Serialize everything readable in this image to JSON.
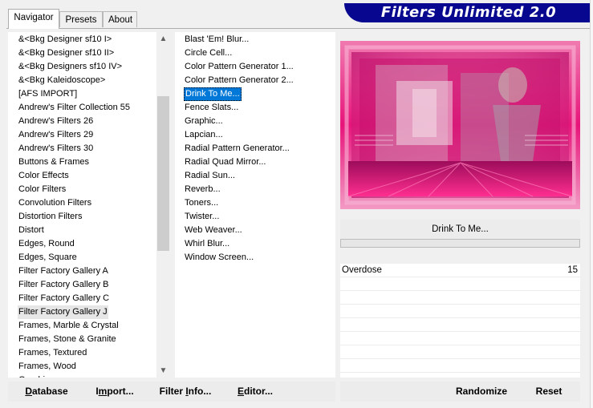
{
  "tabs": [
    {
      "label": "Navigator",
      "active": true
    },
    {
      "label": "Presets",
      "active": false
    },
    {
      "label": "About",
      "active": false
    }
  ],
  "banner": {
    "title": "Filters Unlimited 2.0"
  },
  "categories": [
    "&<Bkg Designer sf10 I>",
    "&<Bkg Designer sf10 II>",
    "&<Bkg Designers sf10 IV>",
    "&<Bkg Kaleidoscope>",
    "[AFS IMPORT]",
    "Andrew's Filter Collection 55",
    "Andrew's Filters 26",
    "Andrew's Filters 29",
    "Andrew's Filters 30",
    "Buttons & Frames",
    "Color Effects",
    "Color Filters",
    "Convolution Filters",
    "Distortion Filters",
    "Distort",
    "Edges, Round",
    "Edges, Square",
    "Filter Factory Gallery A",
    "Filter Factory Gallery B",
    "Filter Factory Gallery C",
    "Filter Factory Gallery J",
    "Frames, Marble & Crystal",
    "Frames, Stone & Granite",
    "Frames, Textured",
    "Frames, Wood",
    "Graphic..."
  ],
  "selected_category": "Filter Factory Gallery J",
  "filters": [
    "Blast 'Em! Blur...",
    "Circle Cell...",
    "Color Pattern Generator 1...",
    "Color Pattern Generator 2...",
    "Drink To Me...",
    "Fence Slats...",
    "Graphic...",
    "Lapcian...",
    "Radial Pattern Generator...",
    "Radial Quad Mirror...",
    "Radial Sun...",
    "Reverb...",
    "Toners...",
    "Twister...",
    "Web Weaver...",
    "Whirl Blur...",
    "Window Screen..."
  ],
  "selected_filter": "Drink To Me...",
  "filter_name": "Drink To Me...",
  "parameters": [
    {
      "name": "Overdose",
      "value": "15"
    }
  ],
  "buttons": {
    "database": {
      "accel": "D",
      "rest": "atabase"
    },
    "import": {
      "pre": "I",
      "accel": "m",
      "rest": "port..."
    },
    "filter_info": {
      "pre": "Filter ",
      "accel": "I",
      "rest": "nfo..."
    },
    "editor": {
      "accel": "E",
      "rest": "ditor..."
    },
    "randomize": "Randomize",
    "reset": "Reset"
  },
  "scroll": {
    "up": "▲",
    "down": "▼"
  },
  "colors": {
    "banner": "#07078f",
    "selection": "#0078d7",
    "preview_pink": "#e8147a"
  }
}
